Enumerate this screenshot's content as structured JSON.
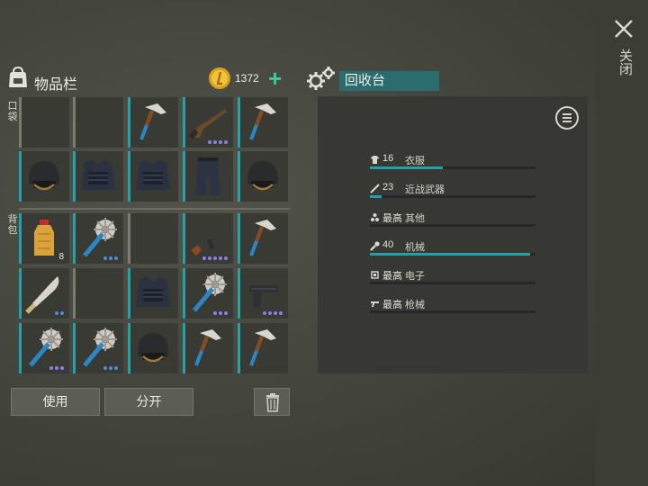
{
  "close": {
    "label": "关闭"
  },
  "inventory": {
    "title": "物品栏",
    "coins": "1372",
    "pocket_label": "口袋",
    "backpack_label": "背包",
    "slots": [
      {
        "item": "",
        "icon": "",
        "bar": "gray",
        "dots": 0
      },
      {
        "item": "",
        "icon": "",
        "bar": "gray",
        "dots": 0
      },
      {
        "item": "axe",
        "icon": "axe-icon",
        "bar": "teal",
        "dots": 0
      },
      {
        "item": "shotgun",
        "icon": "shotgun-icon",
        "bar": "teal",
        "dots": 4
      },
      {
        "item": "axe",
        "icon": "axe-icon",
        "bar": "teal",
        "dots": 0
      },
      {
        "item": "helmet",
        "icon": "helmet-icon",
        "bar": "teal",
        "dots": 0
      },
      {
        "item": "tactical vest",
        "icon": "vest-icon",
        "bar": "teal",
        "dots": 0
      },
      {
        "item": "tactical vest",
        "icon": "vest-icon",
        "bar": "teal",
        "dots": 0
      },
      {
        "item": "tactical pants",
        "icon": "pants-icon",
        "bar": "teal",
        "dots": 0
      },
      {
        "item": "helmet",
        "icon": "helmet-icon",
        "bar": "teal",
        "dots": 0
      },
      {
        "item": "fuel bottle",
        "icon": "bottle-icon",
        "bar": "teal",
        "dots": 0,
        "qty": "8"
      },
      {
        "item": "saw mace",
        "icon": "saw-mace-icon",
        "bar": "teal",
        "dots": 3,
        "dot_color": "#4a8fd6"
      },
      {
        "item": "",
        "icon": "",
        "bar": "gray",
        "dots": 0
      },
      {
        "item": "assault rifle",
        "icon": "rifle-icon",
        "bar": "teal",
        "dots": 5
      },
      {
        "item": "axe",
        "icon": "axe-icon",
        "bar": "teal",
        "dots": 0
      },
      {
        "item": "machete",
        "icon": "machete-icon",
        "bar": "teal",
        "dots": 2,
        "dot_color": "#4a8fd6"
      },
      {
        "item": "",
        "icon": "",
        "bar": "gray",
        "dots": 0
      },
      {
        "item": "tactical vest",
        "icon": "vest-icon",
        "bar": "teal",
        "dots": 0
      },
      {
        "item": "saw mace",
        "icon": "saw-mace-icon",
        "bar": "teal",
        "dots": 3
      },
      {
        "item": "pistol",
        "icon": "pistol-icon",
        "bar": "teal",
        "dots": 4
      },
      {
        "item": "saw mace",
        "icon": "saw-mace-icon",
        "bar": "teal",
        "dots": 3
      },
      {
        "item": "saw mace",
        "icon": "saw-mace-icon",
        "bar": "teal",
        "dots": 3,
        "dot_color": "#4a8fd6"
      },
      {
        "item": "helmet",
        "icon": "helmet-icon",
        "bar": "teal",
        "dots": 0
      },
      {
        "item": "axe",
        "icon": "axe-icon",
        "bar": "teal",
        "dots": 0
      },
      {
        "item": "axe",
        "icon": "axe-icon",
        "bar": "teal",
        "dots": 0
      }
    ],
    "use_label": "使用",
    "split_label": "分开"
  },
  "recycler": {
    "title": "回收台",
    "stats": [
      {
        "icon": "shirt-icon",
        "value": "16",
        "name": "衣服",
        "fill": 0.44
      },
      {
        "icon": "knife-icon",
        "value": "23",
        "name": "近战武器",
        "fill": 0.07
      },
      {
        "icon": "dots-icon",
        "value": "最高",
        "name": "其他",
        "fill": 0
      },
      {
        "icon": "wrench-icon",
        "value": "40",
        "name": "机械",
        "fill": 0.97
      },
      {
        "icon": "chip-icon",
        "value": "最高",
        "name": "电子",
        "fill": 0
      },
      {
        "icon": "gun-icon",
        "value": "最高",
        "name": "枪械",
        "fill": 0
      }
    ]
  },
  "colors": {
    "accent": "#24a0a6",
    "title_bg": "#2b6d6f",
    "plus": "#3fc7a2",
    "rarity_purple": "#8c7fe6",
    "rarity_blue": "#4a8fd6"
  }
}
